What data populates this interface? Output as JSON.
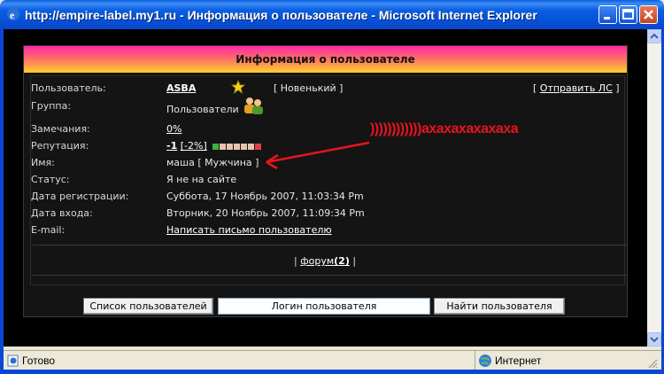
{
  "window": {
    "title": "http://empire-label.my1.ru - Информация о пользователе - Microsoft Internet Explorer"
  },
  "status_bar": {
    "left": "Готово",
    "right": "Интернет"
  },
  "panel": {
    "header": "Информация о пользователе",
    "send_pm": "[ Отправить ЛС ]",
    "send_pm_link": "Отправить ЛС",
    "fields": [
      {
        "label": "Пользователь:",
        "value": "ASBA"
      },
      {
        "label": "Группа:",
        "value": "Пользователи"
      },
      {
        "label": "Замечания:",
        "value": "0%"
      },
      {
        "label": "Репутация:",
        "value": "-1 [-2%]"
      },
      {
        "label": "Имя:",
        "value": "маша [ Мужчина ]"
      },
      {
        "label": "Статус:",
        "value": "Я не на сайте"
      },
      {
        "label": "Дата регистрации:",
        "value": "Суббота, 17 Ноябрь 2007, 11:03:34 Pm"
      },
      {
        "label": "Дата входа:",
        "value": "Вторник, 20 Ноябрь 2007, 11:09:34 Pm"
      },
      {
        "label": "E-mail:",
        "value": "Написать письмо пользователю"
      }
    ],
    "rank": "[ Новенький ]",
    "rep_value": "-1",
    "rep_percent": "[-2%]",
    "forum_link": "форум",
    "forum_count": "(2)",
    "buttons": {
      "user_list": "Список пользователей",
      "login_input": "Логин пользователя",
      "find_user": "Найти пользователя"
    }
  },
  "annotation": {
    "text": "))))))))))))ахахахахахаха",
    "color": "#e8141e"
  },
  "colors": {
    "header_gradient": [
      "#ff2aa8",
      "#ff6b6b",
      "#ffd12a"
    ],
    "panel_bg": "#141414",
    "titlebar": "#0a5ee0"
  }
}
